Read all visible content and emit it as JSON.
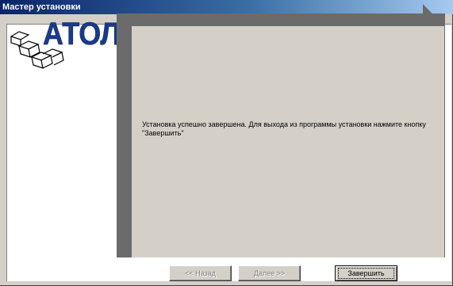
{
  "window": {
    "title": "Мастер установки"
  },
  "logo": {
    "text": "АТОЛ",
    "color": "#1a3a8c"
  },
  "content": {
    "message": "Установка успешно завершена. Для выхода из программы установки нажмите кнопку \"Завершить\""
  },
  "buttons": {
    "back_label": "<< Назад",
    "next_label": "Далее >>",
    "finish_label": "Завершить"
  }
}
